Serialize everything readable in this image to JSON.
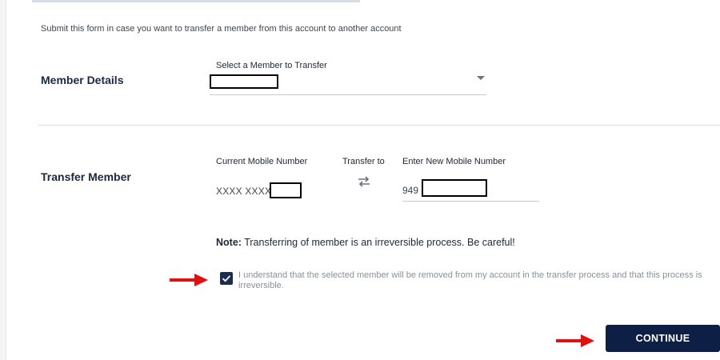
{
  "form": {
    "subtitle": "Submit this form in case you want to transfer a member from this account to another account"
  },
  "member_details": {
    "section_label": "Member Details",
    "select_caption": "Select a Member to Transfer"
  },
  "transfer_member": {
    "section_label": "Transfer Member",
    "current_mobile_caption": "Current Mobile Number",
    "current_mobile_value": "XXXX XXXX",
    "transfer_to_caption": "Transfer to",
    "new_mobile_caption": "Enter New Mobile Number",
    "new_mobile_prefix": "949"
  },
  "note": {
    "label": "Note:",
    "text": "Transferring of member is an irreversible process. Be careful!"
  },
  "consent": {
    "checked": true,
    "text": "I understand that the selected member will be removed from my account in the transfer process and that this process is irreversible."
  },
  "actions": {
    "continue_label": "CONTINUE"
  },
  "colors": {
    "primary": "#0d1f45",
    "checkbox": "#1b2c4f",
    "annotation_arrow": "#e01010"
  },
  "icons": {
    "select_caret": "chevron-down-icon",
    "transfer": "swap-arrows-icon",
    "check": "checkmark-icon",
    "annotation": "red-arrow-icon"
  }
}
